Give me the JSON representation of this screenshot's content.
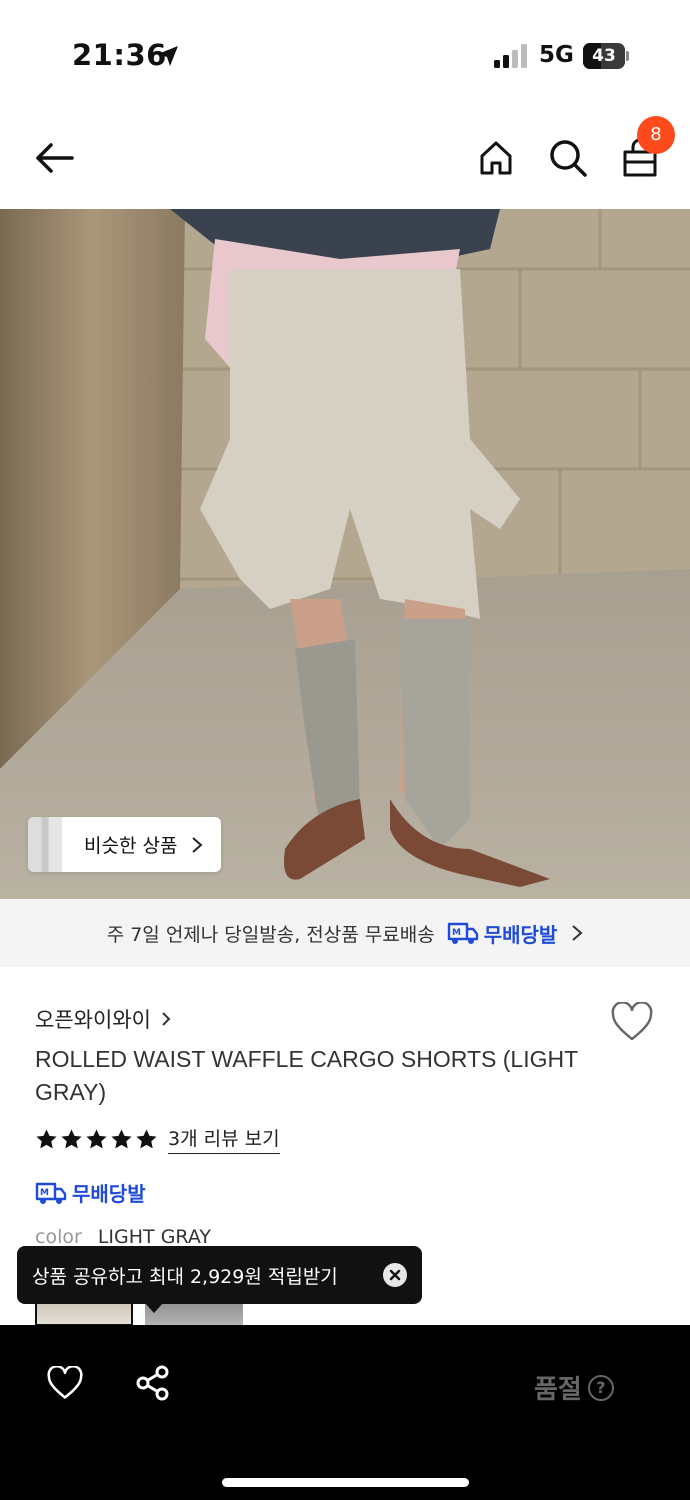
{
  "status_bar": {
    "time": "21:36",
    "network": "5G",
    "battery": "43",
    "battery_level": 0.43
  },
  "nav": {
    "back_icon": "arrow-left-icon",
    "home_icon": "home-icon",
    "search_icon": "search-icon",
    "cart_icon": "shopping-bag-icon",
    "cart_count": "8"
  },
  "hero": {
    "similar_label": "비슷한 상품"
  },
  "delivery_banner": {
    "text": "주 7일 언제나 당일발송, 전상품 무료배송",
    "badge_label": "무배당발"
  },
  "product": {
    "brand": "오픈와이와이",
    "title": "ROLLED WAIST WAFFLE CARGO SHORTS (LIGHT GRAY)",
    "rating": 5,
    "review_link": "3개 리뷰 보기",
    "badge_label": "무배당발",
    "color_key": "color",
    "color_value": "LIGHT GRAY"
  },
  "toast": {
    "text": "상품 공유하고 최대 2,929원 적립받기"
  },
  "bottom_bar": {
    "soldout_label": "품절",
    "help_symbol": "?"
  },
  "colors": {
    "accent_blue": "#1f4bd8",
    "badge_orange": "#ff4a1c"
  }
}
